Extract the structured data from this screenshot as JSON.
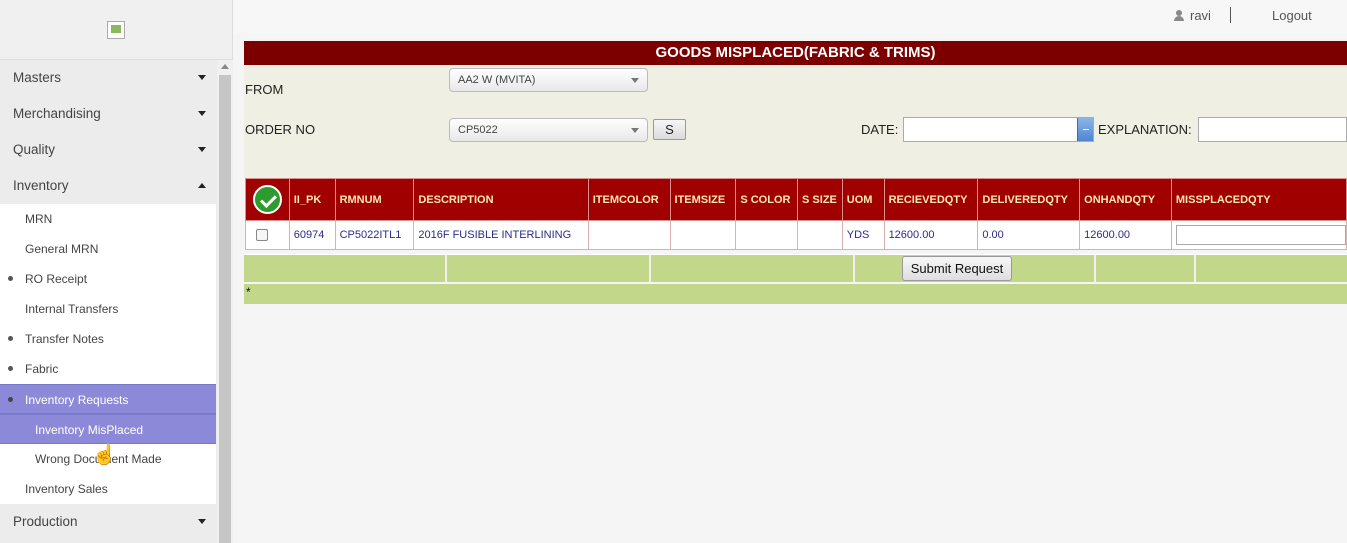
{
  "user": {
    "name": "ravi",
    "logout_label": "Logout"
  },
  "sidebar": {
    "menus": [
      {
        "label": "Masters"
      },
      {
        "label": "Merchandising"
      },
      {
        "label": "Quality"
      },
      {
        "label": "Inventory"
      }
    ],
    "inventory_items": [
      {
        "label": "MRN"
      },
      {
        "label": "General MRN"
      },
      {
        "label": "RO Receipt"
      },
      {
        "label": "Internal Transfers"
      },
      {
        "label": "Transfer Notes"
      },
      {
        "label": "Fabric"
      },
      {
        "label": "Inventory Requests"
      },
      {
        "label": "Inventory MisPlaced"
      },
      {
        "label": "Wrong Document Made"
      },
      {
        "label": "Inventory Sales"
      }
    ],
    "production_label": "Production"
  },
  "page": {
    "title": "GOODS MISPLACED(FABRIC & TRIMS)",
    "from_label": "FROM",
    "from_value": "AA2 W (MVITA)",
    "order_label": "ORDER NO",
    "order_value": "CP5022",
    "s_button": "S",
    "date_label": "DATE:",
    "date_value": "",
    "explanation_label": "EXPLANATION:",
    "explanation_value": ""
  },
  "table": {
    "headers": [
      "II_PK",
      "RMNUM",
      "DESCRIPTION",
      "ITEMCOLOR",
      "ITEMSIZE",
      "S COLOR",
      "S SIZE",
      "UOM",
      "RECIEVEDQTY",
      "DELIVEREDQTY",
      "ONHANDQTY",
      "MISSPLACEDQTY"
    ],
    "rows": [
      {
        "ii_pk": "60974",
        "rmnum": "CP5022ITL1",
        "description": "2016F FUSIBLE INTERLINING",
        "itemcolor": "",
        "itemsize": "",
        "scolor": "",
        "ssize": "",
        "uom": "YDS",
        "recieved": "12600.00",
        "delivered": "0.00",
        "onhand": "12600.00",
        "misplaced": ""
      }
    ]
  },
  "footer": {
    "submit_label": "Submit Request",
    "note": "*"
  },
  "colors": {
    "header": "#7d0000",
    "table_header": "#a00000",
    "footer": "#c3d78a",
    "active_menu": "#8c8ad8"
  }
}
